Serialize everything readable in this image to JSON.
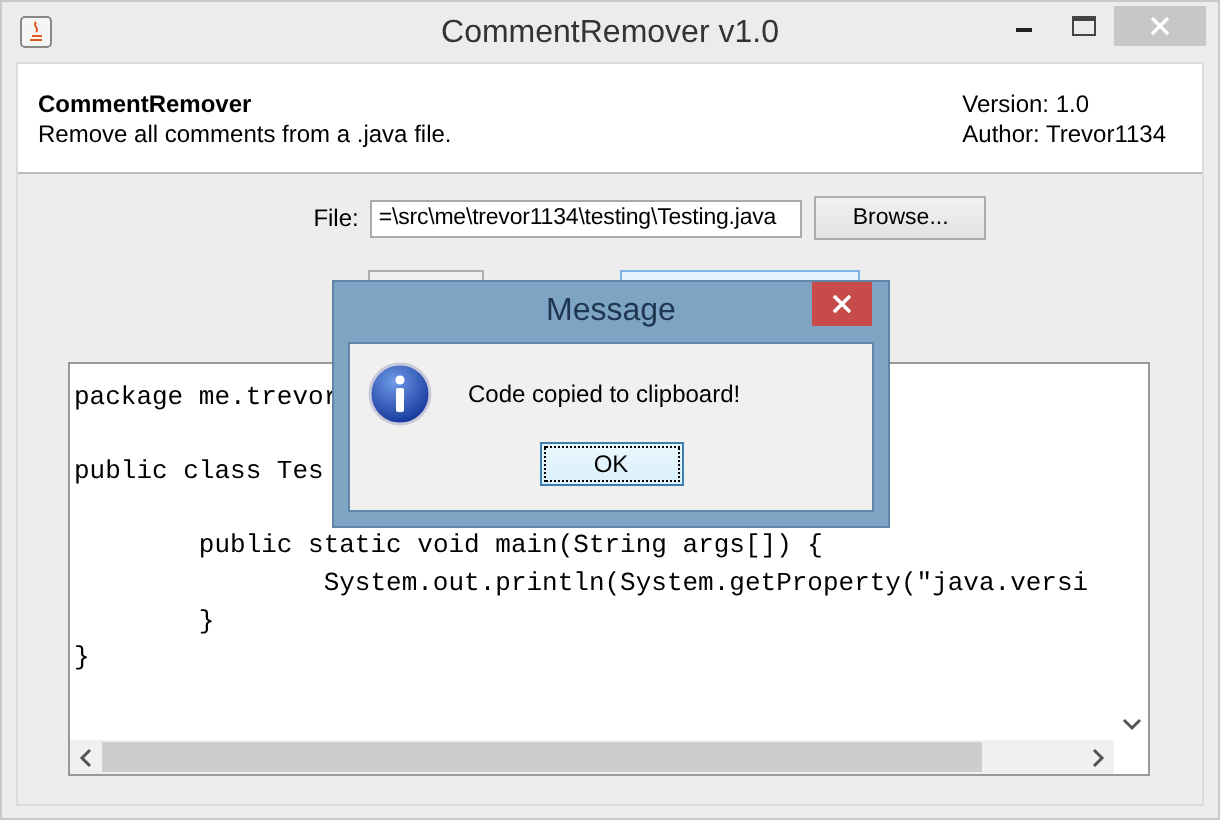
{
  "window": {
    "title": "CommentRemover v1.0"
  },
  "header": {
    "app_name": "CommentRemover",
    "description": "Remove all comments from a .java file.",
    "version": "Version: 1.0",
    "author": "Author: Trevor1134"
  },
  "file_row": {
    "label": "File:",
    "value": "=\\src\\me\\trevor1134\\testing\\Testing.java",
    "browse_button": "Browse..."
  },
  "code_lines": [
    {
      "kind": "code",
      "text": "package me.trevor"
    },
    {
      "kind": "blank"
    },
    {
      "kind": "code",
      "text": "public class Tes"
    },
    {
      "kind": "blank"
    },
    {
      "kind": "code",
      "text": "\tpublic static void main(String args[]) {"
    },
    {
      "kind": "code",
      "text": "\t\tSystem.out.println(System.getProperty(\"java.versi"
    },
    {
      "kind": "code",
      "text": "\t}"
    },
    {
      "kind": "code",
      "text": "}"
    }
  ],
  "dialog": {
    "title": "Message",
    "message": "Code copied to clipboard!",
    "button": "OK"
  }
}
